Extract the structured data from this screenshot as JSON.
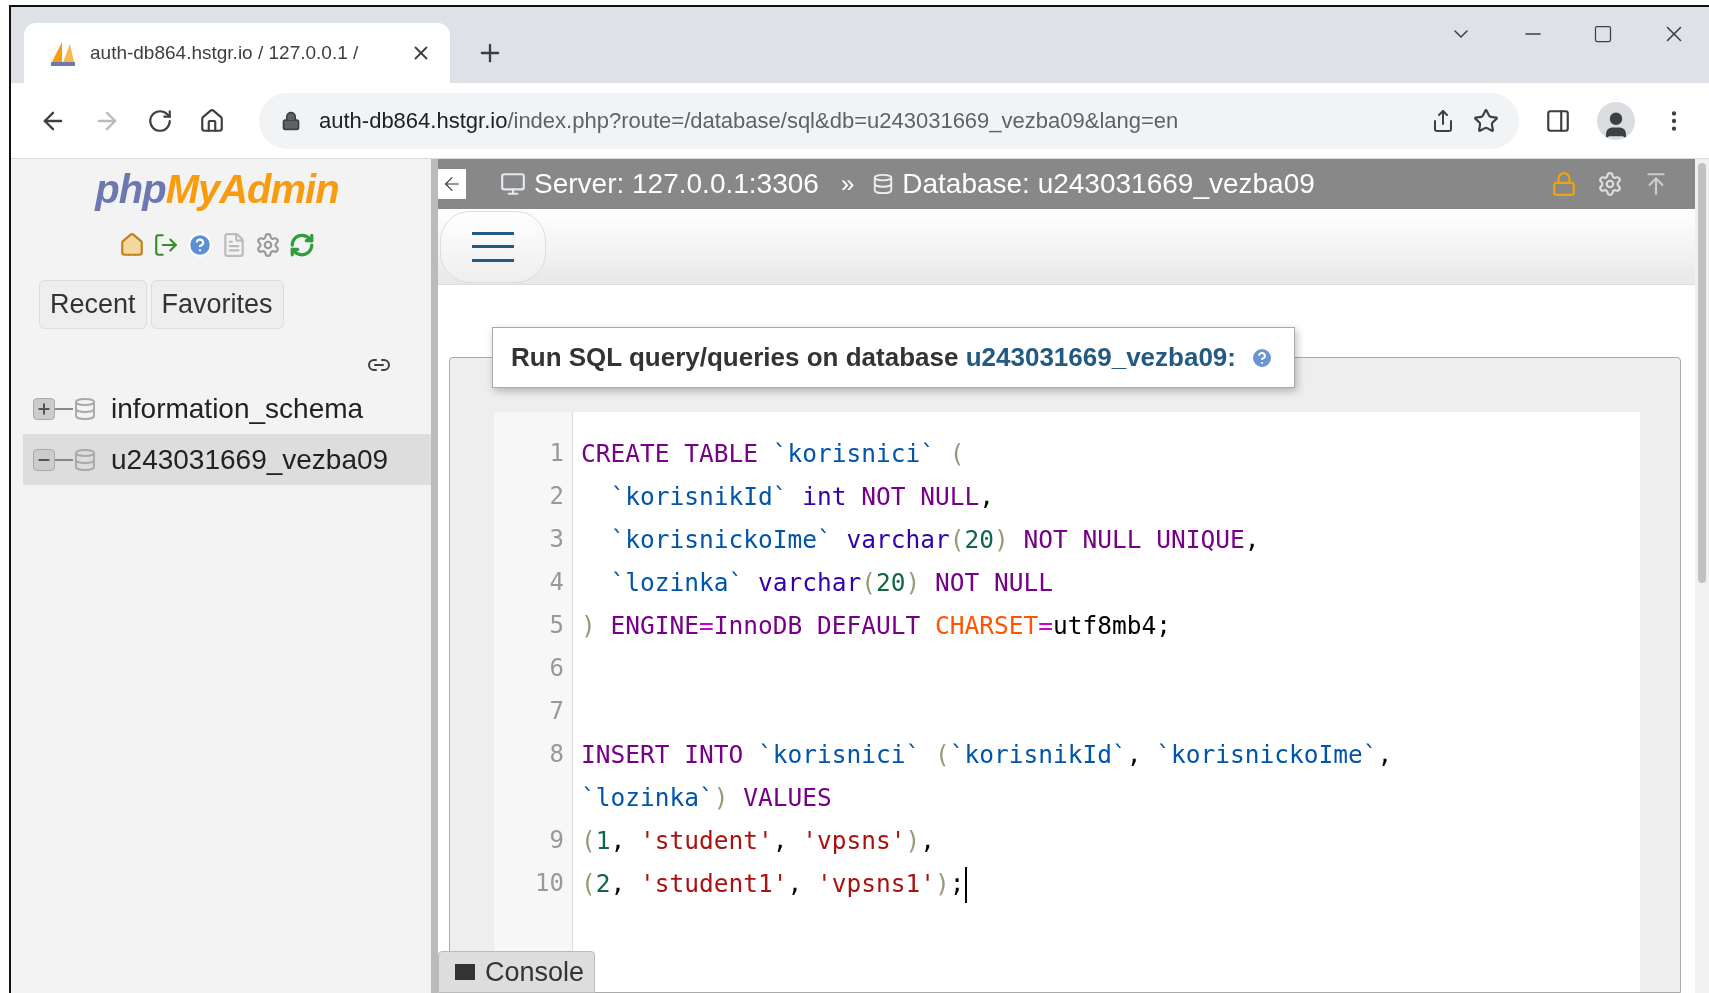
{
  "browser": {
    "tab": {
      "title": "auth-db864.hstgr.io / 127.0.0.1 /",
      "selected": true
    },
    "address": {
      "host": "auth-db864.hstgr.io",
      "path": "/index.php?route=/database/sql&db=u243031669_vezba09&lang=en"
    },
    "forward_disabled": true
  },
  "sidebar": {
    "logo": {
      "part_1": "php",
      "part_2": "MyAdmin"
    },
    "tabs": [
      {
        "label": "Recent"
      },
      {
        "label": "Favorites"
      }
    ],
    "tree": [
      {
        "name": "information_schema",
        "expanded": false,
        "selected": false
      },
      {
        "name": "u243031669_vezba09",
        "expanded": true,
        "selected": true
      }
    ]
  },
  "breadcrumb": {
    "server": "Server: 127.0.0.1:3306",
    "separator": "»",
    "database": "Database: u243031669_vezba09"
  },
  "query": {
    "legend": "Run SQL query/queries on database",
    "database": "u243031669_vezba09:",
    "lines": [
      {
        "number": "1",
        "tokens": [
          {
            "kind": "keyword",
            "text": "CREATE TABLE "
          },
          {
            "kind": "ident",
            "text": "`korisnici`"
          },
          {
            "kind": "paren",
            "text": " ("
          }
        ]
      },
      {
        "number": "2",
        "tokens": [
          {
            "kind": "ident",
            "text": "  `korisnikId`"
          },
          {
            "kind": "type",
            "text": " int"
          },
          {
            "kind": "keyword",
            "text": " NOT NULL"
          },
          {
            "kind": "plain",
            "text": ","
          }
        ]
      },
      {
        "number": "3",
        "tokens": [
          {
            "kind": "ident",
            "text": "  `korisnickoIme`"
          },
          {
            "kind": "type",
            "text": " varchar"
          },
          {
            "kind": "paren",
            "text": "("
          },
          {
            "kind": "number",
            "text": "20"
          },
          {
            "kind": "paren",
            "text": ")"
          },
          {
            "kind": "keyword",
            "text": " NOT NULL UNIQUE"
          },
          {
            "kind": "plain",
            "text": ","
          }
        ]
      },
      {
        "number": "4",
        "tokens": [
          {
            "kind": "ident",
            "text": "  `lozinka`"
          },
          {
            "kind": "type",
            "text": " varchar"
          },
          {
            "kind": "paren",
            "text": "("
          },
          {
            "kind": "number",
            "text": "20"
          },
          {
            "kind": "paren",
            "text": ")"
          },
          {
            "kind": "keyword",
            "text": " NOT NULL"
          }
        ]
      },
      {
        "number": "5",
        "tokens": [
          {
            "kind": "paren",
            "text": ")"
          },
          {
            "kind": "keyword",
            "text": " ENGINE"
          },
          {
            "kind": "operator",
            "text": "="
          },
          {
            "kind": "keyword",
            "text": "InnoDB DEFAULT "
          },
          {
            "kind": "builtin",
            "text": "CHARSET"
          },
          {
            "kind": "operator",
            "text": "="
          },
          {
            "kind": "plain",
            "text": "utf8mb4;"
          }
        ]
      },
      {
        "number": "6"
      },
      {
        "number": "7"
      },
      {
        "number": "8",
        "tokens": [
          {
            "kind": "keyword",
            "text": "INSERT INTO "
          },
          {
            "kind": "ident",
            "text": "`korisnici`"
          },
          {
            "kind": "paren",
            "text": " ("
          },
          {
            "kind": "ident",
            "text": "`korisnikId`"
          },
          {
            "kind": "plain",
            "text": ", "
          },
          {
            "kind": "ident",
            "text": "`korisnickoIme`"
          },
          {
            "kind": "plain",
            "text": ", "
          },
          {
            "kind": "ident",
            "text": "`lozinka`"
          },
          {
            "kind": "paren",
            "text": ")"
          },
          {
            "kind": "keyword",
            "text": " VALUES"
          }
        ]
      },
      {
        "number": "9",
        "tokens": [
          {
            "kind": "paren",
            "text": "("
          },
          {
            "kind": "number",
            "text": "1"
          },
          {
            "kind": "plain",
            "text": ", "
          },
          {
            "kind": "string",
            "text": "'student'"
          },
          {
            "kind": "plain",
            "text": ", "
          },
          {
            "kind": "string",
            "text": "'vpsns'"
          },
          {
            "kind": "paren",
            "text": ")"
          },
          {
            "kind": "plain",
            "text": ","
          }
        ]
      },
      {
        "number": "10",
        "cursor": true,
        "tokens": [
          {
            "kind": "paren",
            "text": "("
          },
          {
            "kind": "number",
            "text": "2"
          },
          {
            "kind": "plain",
            "text": ", "
          },
          {
            "kind": "string",
            "text": "'student1'"
          },
          {
            "kind": "plain",
            "text": ", "
          },
          {
            "kind": "string",
            "text": "'vpsns1'"
          },
          {
            "kind": "paren",
            "text": ")"
          },
          {
            "kind": "plain",
            "text": ";"
          }
        ]
      }
    ]
  },
  "console": {
    "label": "Console"
  }
}
